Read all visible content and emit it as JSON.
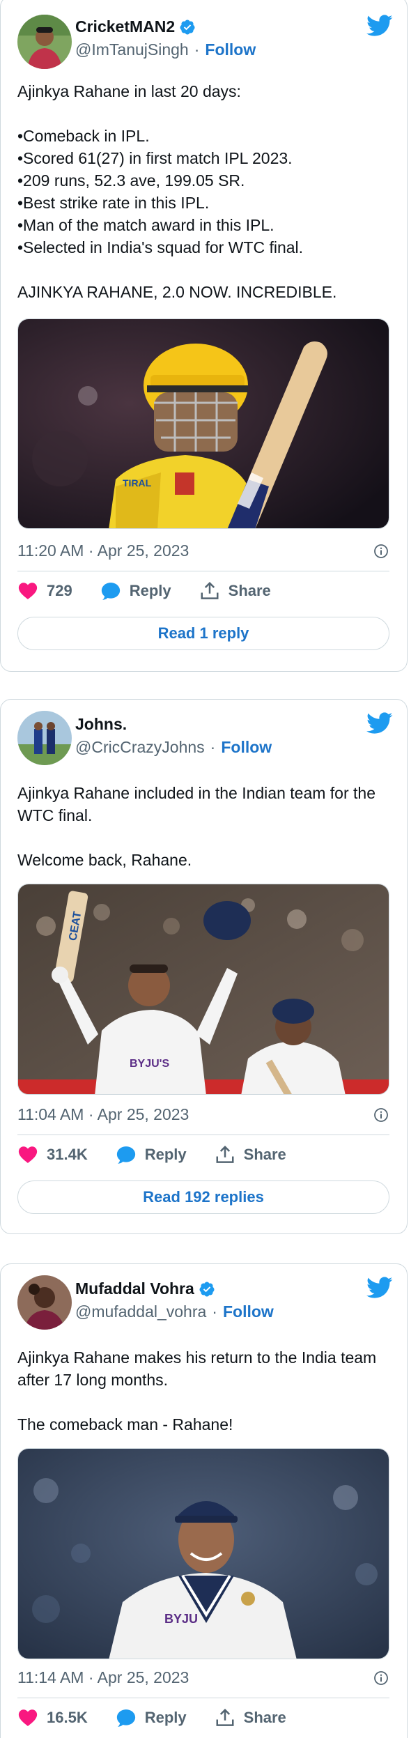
{
  "tweets": [
    {
      "author": "CricketMAN2",
      "verified": true,
      "handle": "@ImTanujSingh",
      "follow_label": "Follow",
      "separator": "·",
      "text": "Ajinkya Rahane in last 20 days:\n\n•Comeback in IPL.\n•Scored 61(27) in first match IPL 2023.\n•209 runs, 52.3 ave, 199.05 SR.\n•Best strike rate in this IPL.\n•Man of the match award in this IPL.\n•Selected in India's squad for WTC final.\n\nAJINKYA RAHANE, 2.0 NOW. INCREDIBLE.",
      "timestamp": "11:20 AM · Apr 25, 2023",
      "likes": "729",
      "reply_label": "Reply",
      "share_label": "Share",
      "read_replies": "Read 1 reply",
      "media_kit_text": "TIRAL"
    },
    {
      "author": "Johns.",
      "verified": false,
      "handle": "@CricCrazyJohns",
      "follow_label": "Follow",
      "separator": "·",
      "text": "Ajinkya Rahane included in the Indian team for the WTC final.\n\nWelcome back, Rahane.",
      "timestamp": "11:04 AM · Apr 25, 2023",
      "likes": "31.4K",
      "reply_label": "Reply",
      "share_label": "Share",
      "read_replies": "Read 192 replies",
      "media_bat_text": "CEAT",
      "media_sponsor": "BYJU'S"
    },
    {
      "author": "Mufaddal Vohra",
      "verified": true,
      "handle": "@mufaddal_vohra",
      "follow_label": "Follow",
      "separator": "·",
      "text": "Ajinkya Rahane makes his return to the India team after 17 long months.\n\nThe comeback man - Rahane!",
      "timestamp": "11:14 AM · Apr 25, 2023",
      "likes": "16.5K",
      "reply_label": "Reply",
      "share_label": "Share",
      "media_sponsor": "BYJU"
    }
  ],
  "colors": {
    "accent": "#1d9bf0",
    "link": "#1d74c9",
    "heart": "#f91880",
    "muted": "#536471",
    "border": "#cfd9de"
  },
  "icons": [
    "twitter-bird-icon",
    "verified-badge-icon",
    "info-icon",
    "heart-icon",
    "reply-bubble-icon",
    "share-icon"
  ]
}
